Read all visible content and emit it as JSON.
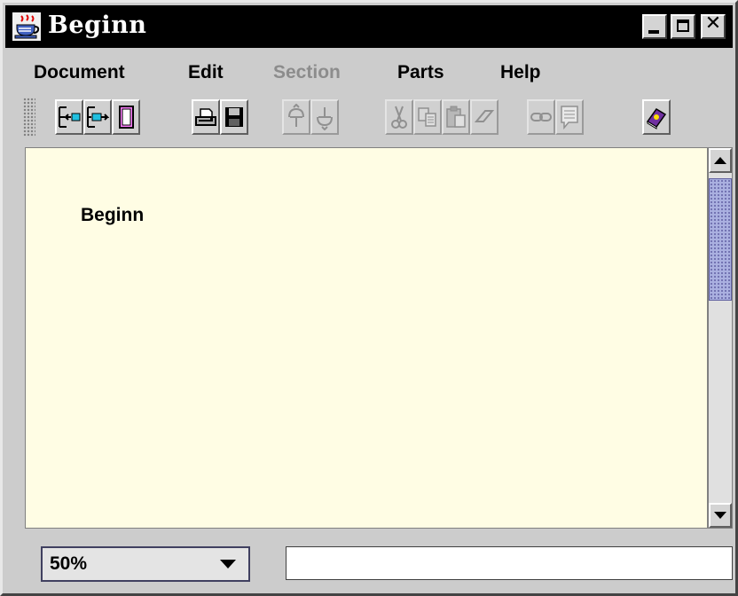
{
  "window": {
    "title": "Beginn",
    "app_icon": "java-cup-icon",
    "buttons": [
      "minimize-icon",
      "maximize-icon",
      "close-icon"
    ],
    "close_glyph": "✕"
  },
  "menu": {
    "items": [
      {
        "label": "Document",
        "enabled": true
      },
      {
        "label": "Edit",
        "enabled": true
      },
      {
        "label": "Section",
        "enabled": false
      },
      {
        "label": "Parts",
        "enabled": true
      },
      {
        "label": "Help",
        "enabled": true
      }
    ]
  },
  "toolbar": {
    "buttons": [
      {
        "icon": "indent-left-icon",
        "enabled": true
      },
      {
        "icon": "indent-right-icon",
        "enabled": true
      },
      {
        "icon": "page-icon",
        "enabled": true
      },
      {
        "icon": "print-icon",
        "enabled": true
      },
      {
        "icon": "save-icon",
        "enabled": true
      },
      {
        "icon": "move-up-icon",
        "enabled": false
      },
      {
        "icon": "move-down-icon",
        "enabled": false
      },
      {
        "icon": "cut-icon",
        "enabled": false
      },
      {
        "icon": "copy-icon",
        "enabled": false
      },
      {
        "icon": "paste-icon",
        "enabled": false
      },
      {
        "icon": "eraser-icon",
        "enabled": false
      },
      {
        "icon": "link-icon",
        "enabled": false
      },
      {
        "icon": "comment-icon",
        "enabled": false
      },
      {
        "icon": "help-book-icon",
        "enabled": true
      }
    ]
  },
  "document": {
    "title": "Beginn",
    "background": "#fffde4"
  },
  "status": {
    "zoom": "50%",
    "message": ""
  },
  "colors": {
    "titlebar": "#000000",
    "disabled_text": "#8c8c8c",
    "scroll_thumb": "#aab0e0"
  }
}
